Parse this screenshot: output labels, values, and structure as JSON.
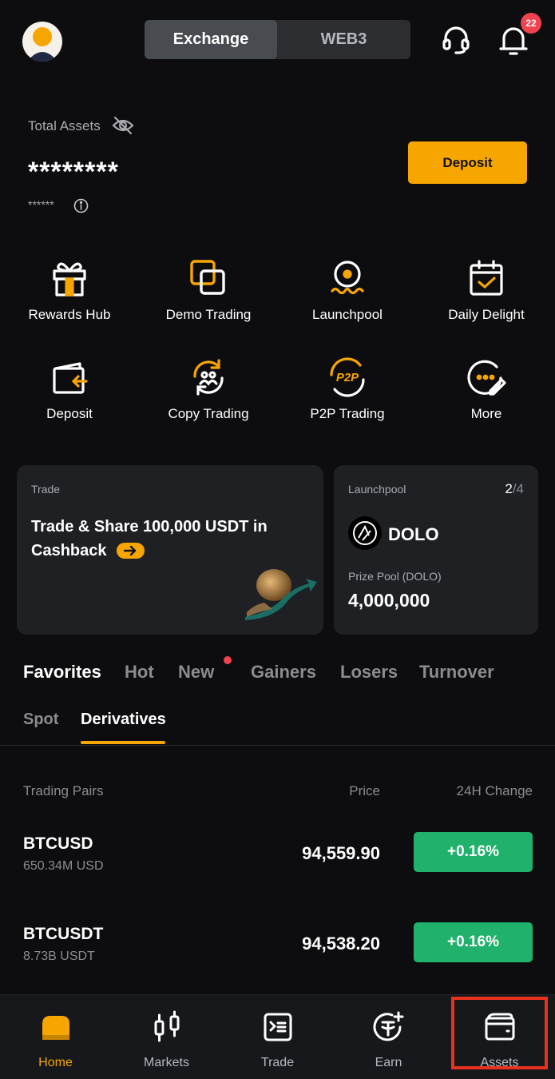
{
  "header": {
    "segments": [
      {
        "label": "Exchange",
        "active": true
      },
      {
        "label": "WEB3",
        "active": false
      }
    ],
    "notification_count": "22",
    "icons": [
      "avatar",
      "headset-icon",
      "bell-icon"
    ]
  },
  "assets": {
    "label": "Total Assets",
    "masked_value": "********",
    "masked_sub": "******",
    "deposit_label": "Deposit"
  },
  "quick_actions": [
    {
      "label": "Rewards Hub",
      "icon": "gift-icon"
    },
    {
      "label": "Demo Trading",
      "icon": "demo-trading-icon"
    },
    {
      "label": "Launchpool",
      "icon": "launchpool-icon"
    },
    {
      "label": "Daily Delight",
      "icon": "calendar-check-icon"
    },
    {
      "label": "Deposit",
      "icon": "deposit-icon"
    },
    {
      "label": "Copy Trading",
      "icon": "copy-trading-icon"
    },
    {
      "label": "P2P Trading",
      "icon": "p2p-icon"
    },
    {
      "label": "More",
      "icon": "more-icon"
    }
  ],
  "promo_trade": {
    "tag": "Trade",
    "title_line1": "Trade & Share 100,000 USDT in",
    "title_line2": "Cashback"
  },
  "promo_launchpool": {
    "tag": "Launchpool",
    "page_current": "2",
    "page_total": "/4",
    "token": "DOLO",
    "pool_label": "Prize Pool (DOLO)",
    "pool_value": "4,000,000"
  },
  "market_tabs": [
    "Favorites",
    "Hot",
    "New",
    "Gainers",
    "Losers",
    "Turnover"
  ],
  "sub_tabs": [
    "Spot",
    "Derivatives"
  ],
  "table": {
    "headers": [
      "Trading Pairs",
      "Price",
      "24H Change"
    ],
    "rows": [
      {
        "pair": "BTCUSD",
        "volume": "650.34M USD",
        "price": "94,559.90",
        "change": "+0.16%"
      },
      {
        "pair": "BTCUSDT",
        "volume": "8.73B USDT",
        "price": "94,538.20",
        "change": "+0.16%"
      }
    ]
  },
  "bottom_nav": [
    {
      "label": "Home",
      "active": true
    },
    {
      "label": "Markets",
      "active": false
    },
    {
      "label": "Trade",
      "active": false
    },
    {
      "label": "Earn",
      "active": false
    },
    {
      "label": "Assets",
      "active": false
    }
  ],
  "colors": {
    "accent": "#f7a600",
    "positive": "#20b26c",
    "background": "#0d0d10",
    "card": "#1f2024",
    "badge": "#f0434f",
    "highlight": "#e8321f"
  }
}
